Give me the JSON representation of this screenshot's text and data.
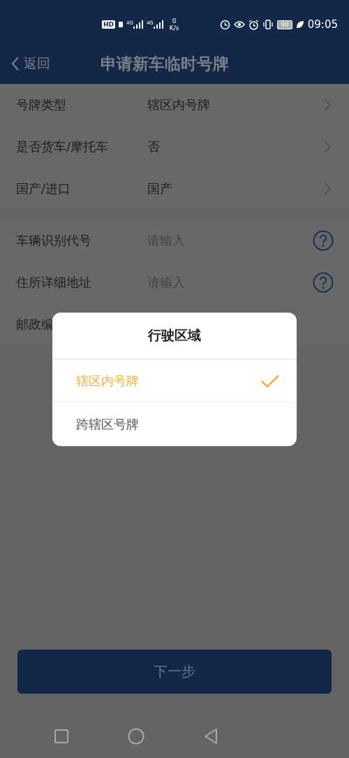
{
  "status_bar": {
    "hd": "HD",
    "signals": [
      "4G",
      "4G"
    ],
    "speed_value": "0",
    "speed_unit": "K/s",
    "battery": "90",
    "time": "09:05"
  },
  "header": {
    "back": "返回",
    "title": "申请新车临时号牌"
  },
  "sections": [
    {
      "rows": [
        {
          "kind": "select",
          "label": "号牌类型",
          "value": "辖区内号牌"
        },
        {
          "kind": "select",
          "label": "是否货车/摩托车",
          "value": "否"
        },
        {
          "kind": "select",
          "label": "国产/进口",
          "value": "国产"
        }
      ]
    },
    {
      "rows": [
        {
          "kind": "input",
          "label": "车辆识别代号",
          "placeholder": "请输入"
        },
        {
          "kind": "input",
          "label": "住所详细地址",
          "placeholder": "请输入"
        },
        {
          "kind": "plain",
          "label": "邮政编"
        }
      ]
    }
  ],
  "dialog": {
    "title": "行驶区域",
    "options": [
      {
        "label": "辖区内号牌",
        "selected": true
      },
      {
        "label": "跨辖区号牌",
        "selected": false
      }
    ]
  },
  "next_button": "下一步"
}
